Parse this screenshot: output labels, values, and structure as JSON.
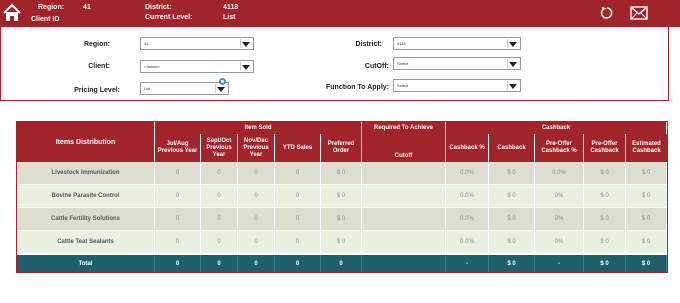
{
  "header": {
    "region_label": "Region:",
    "region_value": "41",
    "client_id_label": "Client ID",
    "district_label": "District:",
    "district_value": "4118",
    "current_level_label": "Current Level:",
    "current_level_value": "List"
  },
  "filters": {
    "region": {
      "label": "Region:",
      "value": "41"
    },
    "client": {
      "label": "Client:",
      "value": "<Select>"
    },
    "pricing_level": {
      "label": "Pricing Level:",
      "value": "List"
    },
    "district": {
      "label": "District:",
      "value": "4118"
    },
    "cutoff": {
      "label": "CutOff:",
      "value": "Select"
    },
    "function": {
      "label": "Function To Apply:",
      "value": "Select"
    }
  },
  "table": {
    "title": "Items Distribution",
    "item_sold_label": "Item Sold",
    "required_label": "Required To Achieve",
    "cutoff_label": "Cutoff",
    "cashback_group_label": "Cashback",
    "sold_columns": [
      "Jul/Aug Previous Year",
      "Sept/Oct Previous Year",
      "Nov/Dec Previous Year",
      "YTD Sales",
      "Preferred Order"
    ],
    "cashback_columns": [
      "Cashback %",
      "Cashback",
      "Pre-Offer Cashback %",
      "Pre-Offer Cashback",
      "Estimated Cashback"
    ],
    "rows": [
      {
        "name": "Livestock Immunization",
        "jul": "0",
        "sep": "0",
        "nov": "0",
        "ytd": "0",
        "pref": "$ 0",
        "cutoff": "",
        "cb_pct": "0.0%",
        "cb": "$ 0",
        "pre_pct": "0.0%",
        "pre_cb": "$ 0",
        "est": "$ 0"
      },
      {
        "name": "Bovine Parasite Control",
        "jul": "0",
        "sep": "0",
        "nov": "0",
        "ytd": "0",
        "pref": "$ 0",
        "cutoff": "",
        "cb_pct": "0.0%",
        "cb": "$ 0",
        "pre_pct": "0%",
        "pre_cb": "$ 0",
        "est": "$ 0"
      },
      {
        "name": "Cattle Fertility Solutions",
        "jul": "0",
        "sep": "0",
        "nov": "0",
        "ytd": "0",
        "pref": "$ 0",
        "cutoff": "",
        "cb_pct": "0.0%",
        "cb": "$ 0",
        "pre_pct": "0%",
        "pre_cb": "$ 0",
        "est": "$ 0"
      },
      {
        "name": "Cattle Teat Sealants",
        "jul": "0",
        "sep": "0",
        "nov": "0",
        "ytd": "0",
        "pref": "$ 0",
        "cutoff": "",
        "cb_pct": "0.0%",
        "cb": "$ 0",
        "pre_pct": "0%",
        "pre_cb": "$ 0",
        "est": "$ 0"
      }
    ],
    "total": {
      "name": "Total",
      "jul": "0",
      "sep": "0",
      "nov": "0",
      "ytd": "0",
      "pref": "0",
      "cutoff": "",
      "cb_pct": "-",
      "cb": "$ 0",
      "pre_pct": "-",
      "pre_cb": "$ 0",
      "est": "$ 0"
    }
  },
  "icons": [
    "home-icon",
    "refresh-icon",
    "mail-icon"
  ],
  "colors": {
    "accent": "#a0242a",
    "total_row": "#1f5f6a",
    "row_odd": "#dcdfcf",
    "row_even": "#eaf0df"
  }
}
